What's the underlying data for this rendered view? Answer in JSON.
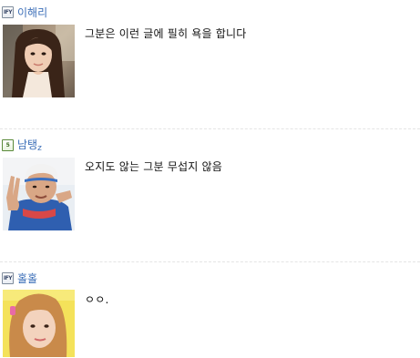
{
  "comments": [
    {
      "level_icon": "level-badge-icon",
      "level_text": "IFY",
      "author": "이해리",
      "author_suffix": "",
      "text": "그분은 이런 글에 필히 욕을 합니다",
      "avatar": "woman-long-hair-photo"
    },
    {
      "level_icon": "level-badge-icon",
      "level_text": "5",
      "author": "남탱",
      "author_suffix": "z",
      "text": "오지도 않는 그분 무섭지 않음",
      "avatar": "man-peace-sign-photo"
    },
    {
      "level_icon": "level-badge-icon",
      "level_text": "IFY",
      "author": "홀홀",
      "author_suffix": "",
      "text": "ㅇㅇ.",
      "avatar": "girl-yellow-background-photo"
    }
  ],
  "colors": {
    "author_link": "#3d6fb8",
    "text": "#111111",
    "divider": "#e4e4e4"
  }
}
